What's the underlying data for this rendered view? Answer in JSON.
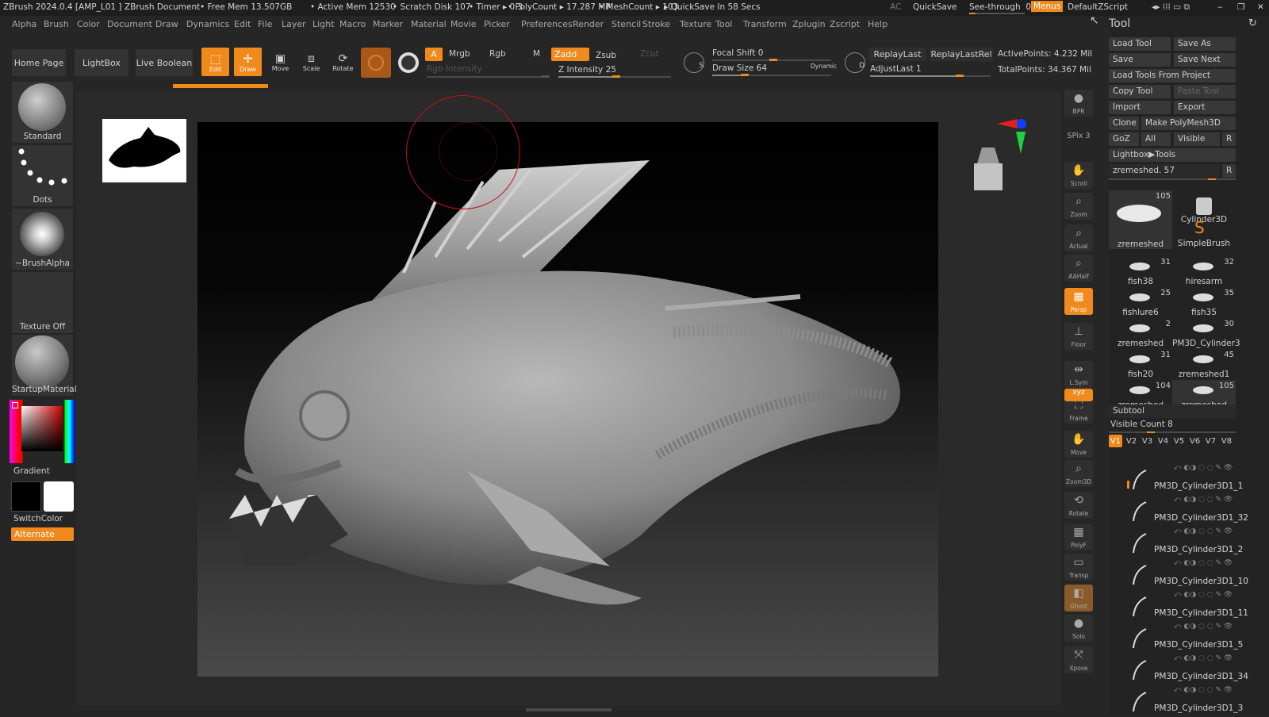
{
  "title_bar": {
    "app": "ZBrush 2024.0.4 [AMP_L01 ]",
    "doc": "ZBrush Document",
    "free_mem": "• Free Mem 13.507GB",
    "active_mem": "• Active Mem 12530",
    "scratch": "• Scratch Disk 107",
    "timer": "• Timer ▸ 0.3",
    "polycount": "• PolyCount ▸ 17.287 MP",
    "meshcount": "• MeshCount ▸ 103",
    "quicksave_in": "▸ QuickSave In 58 Secs",
    "ac": "AC",
    "quicksave": "QuickSave",
    "see_through": "See-through",
    "see_through_val": "0",
    "menus": "Menus",
    "script": "DefaultZScript"
  },
  "menu": [
    "Alpha",
    "Brush",
    "Color",
    "Document",
    "Draw",
    "Dynamics",
    "Edit",
    "File",
    "Layer",
    "Light",
    "Macro",
    "Marker",
    "Material",
    "Movie",
    "Picker",
    "Preferences",
    "Render",
    "Stencil",
    "Stroke",
    "Texture",
    "Tool",
    "Transform",
    "Zplugin",
    "Zscript",
    "Help"
  ],
  "top_shelf": {
    "home": "Home Page",
    "lightbox": "LightBox",
    "live_boolean": "Live Boolean",
    "edit": "Edit",
    "draw": "Draw",
    "move": "Move",
    "scale": "Scale",
    "rotate": "Rotate",
    "a": "A",
    "mrgb": "Mrgb",
    "rgb": "Rgb",
    "m": "M",
    "zadd": "Zadd",
    "zsub": "Zsub",
    "zcut": "Zcut",
    "rgb_intensity": "Rgb Intensity",
    "z_intensity": "Z Intensity 25",
    "focal_shift": "Focal Shift 0",
    "draw_size": "Draw Size 64",
    "dynamic": "Dynamic",
    "replay_last": "ReplayLast",
    "replay_last_rel": "ReplayLastRel",
    "adjust_last": "AdjustLast 1",
    "active_points": "ActivePoints: 4.232 Mil",
    "total_points": "TotalPoints: 34.367 Mil",
    "s": "S",
    "d": "D"
  },
  "left_shelf": {
    "standard": "Standard",
    "dots": "Dots",
    "brush_alpha": "~BrushAlpha",
    "texture_off": "Texture Off",
    "startup_material": "StartupMaterial",
    "gradient": "Gradient",
    "switch_color": "SwitchColor",
    "alternate": "Alternate"
  },
  "right_shelf": [
    "BPR",
    "SPix 3",
    "Scroll",
    "Zoom",
    "Actual",
    "AAHalf",
    "Persp",
    "Floor",
    "L.Sym",
    "Frame",
    "Move",
    "Zoom3D",
    "Rotate",
    "PolyF",
    "Transp",
    "Ghost",
    "Solo",
    "Xpose"
  ],
  "tool_panel": {
    "header": "Tool",
    "load_tool": "Load Tool",
    "save_as": "Save As",
    "save": "Save",
    "save_next": "Save Next",
    "load_from_project": "Load Tools From Project",
    "copy_tool": "Copy Tool",
    "paste_tool": "Paste Tool",
    "import": "Import",
    "export": "Export",
    "clone": "Clone",
    "make_polymesh": "Make PolyMesh3D",
    "goz": "GoZ",
    "all": "All",
    "visible": "Visible",
    "r": "R",
    "lightbox_tools": "Lightbox▶Tools",
    "current": "zremeshed. 57",
    "thumbs": [
      {
        "name": "zremeshed",
        "num": "105"
      },
      {
        "name": "Cylinder3D",
        "num": ""
      },
      {
        "name": "SimpleBrush",
        "num": ""
      },
      {
        "name": "fish38",
        "num": "31"
      },
      {
        "name": "hiresarm",
        "num": "32"
      },
      {
        "name": "fishlure6",
        "num": "25"
      },
      {
        "name": "fish35",
        "num": "35"
      },
      {
        "name": "zremeshed",
        "num": "2"
      },
      {
        "name": "PM3D_Cylinder3",
        "num": "30"
      },
      {
        "name": "fish20",
        "num": "31"
      },
      {
        "name": "zremeshed1",
        "num": "45"
      },
      {
        "name": "zremeshed",
        "num": "104"
      },
      {
        "name": "zremeshed",
        "num": "105"
      }
    ],
    "subtool_header": "Subtool",
    "visible_count": "Visible Count 8",
    "versions": [
      "V1",
      "V2",
      "V3",
      "V4",
      "V5",
      "V6",
      "V7",
      "V8"
    ],
    "subtools": [
      "PM3D_Cylinder3D1_1",
      "PM3D_Cylinder3D1_32",
      "PM3D_Cylinder3D1_2",
      "PM3D_Cylinder3D1_10",
      "PM3D_Cylinder3D1_11",
      "PM3D_Cylinder3D1_5",
      "PM3D_Cylinder3D1_34",
      "PM3D_Cylinder3D1_3"
    ]
  },
  "colors": {
    "accent": "#f08a1c",
    "primary_color": "#000000",
    "secondary_color": "#ffffff"
  }
}
